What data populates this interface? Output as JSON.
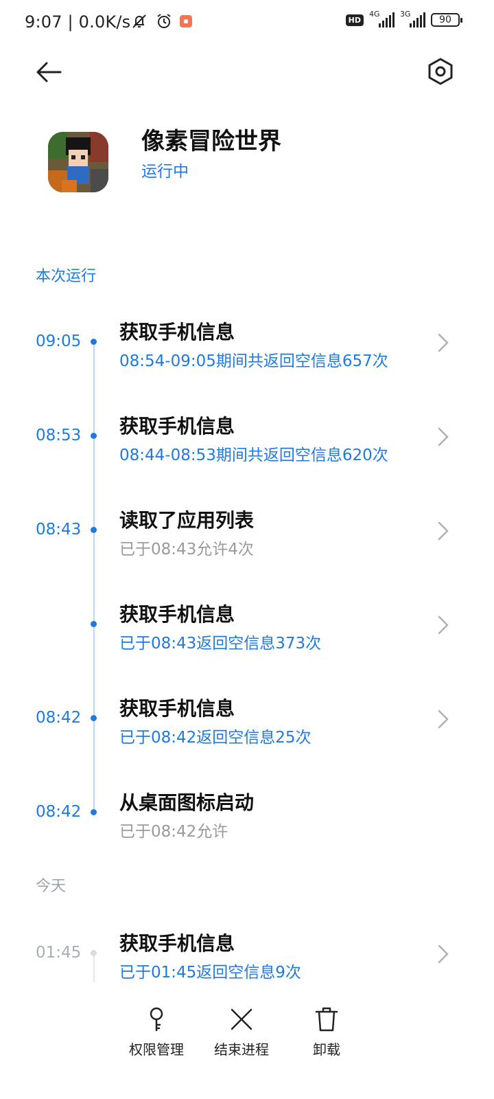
{
  "status_bar": {
    "time": "9:07",
    "network_speed": "0.0K/s",
    "hd_badge": "HD",
    "sim1_type": "4G",
    "sim2_type": "3G",
    "battery": "90",
    "icons": [
      "mute-icon",
      "alarm-icon",
      "taobao-notification-icon"
    ]
  },
  "header": {
    "back_icon": "arrow-left-icon",
    "settings_icon": "hexagon-settings-icon"
  },
  "app": {
    "name": "像素冒险世界",
    "status": "运行中"
  },
  "sections": {
    "current_run": "本次运行",
    "today": "今天"
  },
  "entries": [
    {
      "time": "09:05",
      "title": "获取手机信息",
      "subtitle": "08:54-09:05期间共返回空信息657次",
      "subtitle_style": "blue",
      "has_chevron": true
    },
    {
      "time": "08:53",
      "title": "获取手机信息",
      "subtitle": "08:44-08:53期间共返回空信息620次",
      "subtitle_style": "blue",
      "has_chevron": true
    },
    {
      "time": "08:43",
      "title": "读取了应用列表",
      "subtitle": "已于08:43允许4次",
      "subtitle_style": "gray",
      "has_chevron": true
    },
    {
      "time": "",
      "title": "获取手机信息",
      "subtitle": "已于08:43返回空信息373次",
      "subtitle_style": "blue",
      "has_chevron": true
    },
    {
      "time": "08:42",
      "title": "获取手机信息",
      "subtitle": "已于08:42返回空信息25次",
      "subtitle_style": "blue",
      "has_chevron": true
    },
    {
      "time": "08:42",
      "title": "从桌面图标启动",
      "subtitle": "已于08:42允许",
      "subtitle_style": "gray",
      "has_chevron": false
    }
  ],
  "today_entries": [
    {
      "time": "01:45",
      "title": "获取手机信息",
      "subtitle": "已于01:45返回空信息9次",
      "subtitle_style": "blue",
      "has_chevron": true
    }
  ],
  "bottom_bar": {
    "permissions": "权限管理",
    "end_process": "结束进程",
    "uninstall": "卸载"
  },
  "colors": {
    "accent": "#1f7ae0",
    "muted": "#9a9a9a",
    "section_gray": "#9aa3ad"
  }
}
